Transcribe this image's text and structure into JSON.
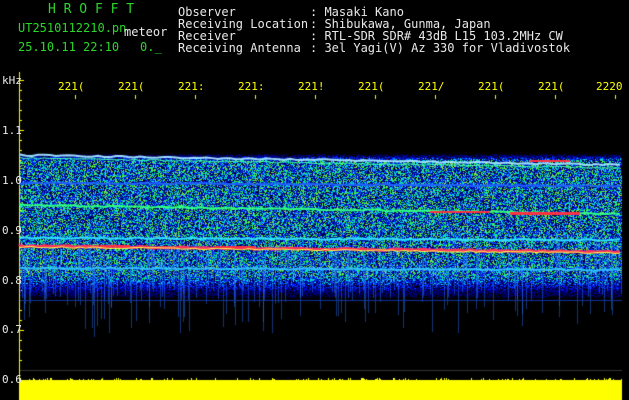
{
  "header": {
    "brand": "H R O F F T",
    "file_name": "UT2510112210.pn",
    "subtitle": "meteor",
    "datetime": "25.10.11 22:10",
    "status": "0._",
    "info": [
      {
        "label": "Observer",
        "value": ": Masaki Kano"
      },
      {
        "label": "Receiving Location",
        "value": ": Shibukawa, Gunma, Japan"
      },
      {
        "label": "Receiver",
        "value": ": RTL-SDR SDR# 43dB L15 103.2MHz CW"
      },
      {
        "label": "Receiving Antenna",
        "value": ": 3el Yagi(V) Az 330 for Vladivostok"
      }
    ]
  },
  "y_axis": {
    "unit": "kHz",
    "ticks": [
      "1.1",
      "1.0",
      "0.9",
      "0.8",
      "0.7",
      "0.6"
    ]
  },
  "x_axis": {
    "ticks": [
      "221(",
      "221(",
      "221:",
      "221:",
      "221!",
      "221(",
      "221/",
      "221(",
      "221(",
      "2220"
    ]
  },
  "colors": {
    "background": "#000000",
    "brand": "#2bd62b",
    "text": "#e8e8e8",
    "time_labels": "#ffff00",
    "level_bar": "#ffff00"
  }
}
